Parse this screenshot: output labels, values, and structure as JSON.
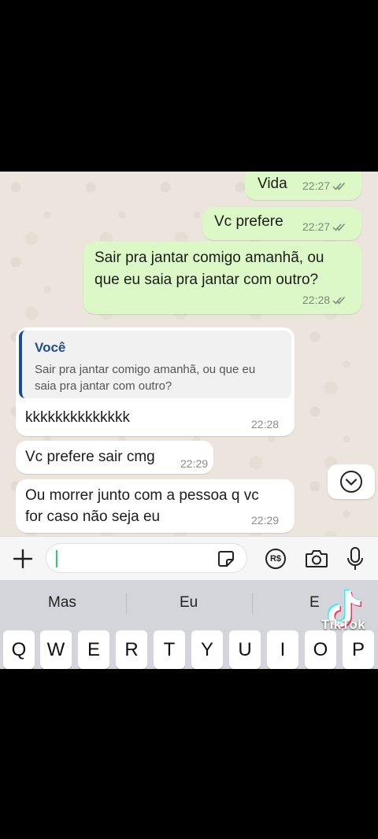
{
  "messages": [
    {
      "direction": "out",
      "text": "Vida",
      "time": "22:27",
      "status": "read"
    },
    {
      "direction": "out",
      "text": "Vc prefere",
      "time": "22:27",
      "status": "read"
    },
    {
      "direction": "out",
      "text_lines": [
        "Sair pra jantar comigo amanhã, ou",
        "que eu saia pra jantar com outro?"
      ],
      "time": "22:28",
      "status": "read"
    },
    {
      "direction": "in",
      "quote": {
        "author": "Você",
        "text_lines": [
          "Sair pra jantar comigo amanhã, ou que eu",
          "saia pra jantar com outro?"
        ]
      },
      "text": "kkkkkkkkkkkkkk",
      "time": "22:28"
    },
    {
      "direction": "in",
      "text": "Vc prefere sair cmg",
      "time": "22:29"
    },
    {
      "direction": "in",
      "text_lines": [
        "Ou morrer junto com a pessoa q vc",
        "for caso não seja eu"
      ],
      "time": "22:29"
    }
  ],
  "composer": {
    "input_value": "",
    "icons": [
      "plus-icon",
      "sticker-icon",
      "payment-icon",
      "camera-icon",
      "microphone-icon"
    ],
    "payment_label": "R$"
  },
  "keyboard": {
    "suggestions": [
      "Mas",
      "Eu",
      "E"
    ],
    "row1": [
      "Q",
      "W",
      "E",
      "R",
      "T",
      "Y",
      "U",
      "I",
      "O",
      "P"
    ]
  },
  "watermark": {
    "brand": "TikTok",
    "handle": "@"
  },
  "colors": {
    "outgoing_bubble": "#dcf8c6",
    "incoming_bubble": "#ffffff",
    "chat_background": "#ece5dd",
    "quote_author": "#1f4e8d",
    "read_ticks": "#7a8a7a"
  }
}
